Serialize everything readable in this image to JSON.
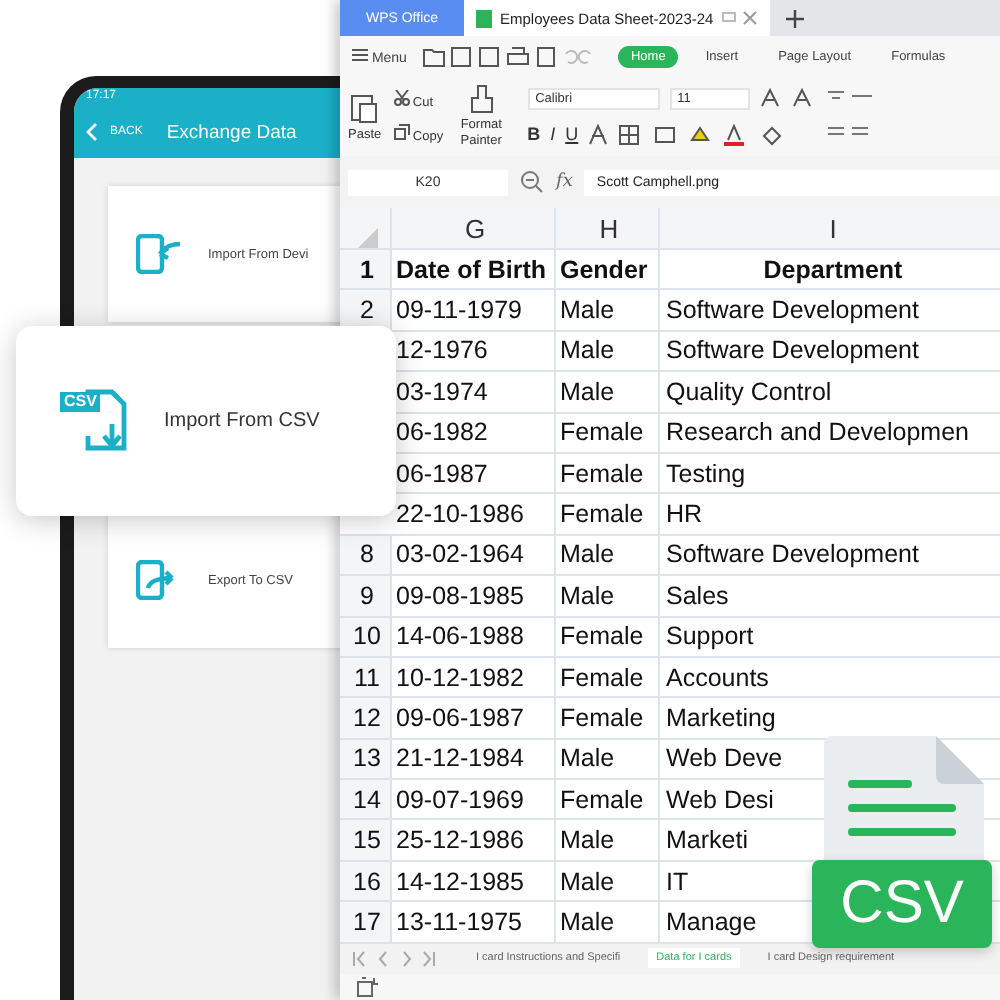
{
  "phone": {
    "time": "17:17",
    "back": "BACK",
    "title": "Exchange Data",
    "options": [
      {
        "label": "Import From Devi",
        "kind": "import"
      },
      {
        "label": "Export To CSV",
        "kind": "export"
      }
    ]
  },
  "popup_option": {
    "label": "Import From CSV",
    "badge": "CSV"
  },
  "spreadsheet": {
    "app_tab": "WPS Office",
    "doc_tab": "Employees Data Sheet-2023-24",
    "menu": "Menu",
    "ribbon_tabs": [
      {
        "label": "Home",
        "selected": true
      },
      {
        "label": "Insert",
        "selected": false
      },
      {
        "label": "Page Layout",
        "selected": false
      },
      {
        "label": "Formulas",
        "selected": false
      }
    ],
    "clipboard": {
      "paste": "Paste",
      "cut": "Cut",
      "copy": "Copy",
      "format_painter": "Format Painter"
    },
    "font": {
      "name": "Calibri",
      "size": "11"
    },
    "format_buttons": [
      "B",
      "I",
      "U"
    ],
    "cell_ref": "K20",
    "fx": "fx",
    "formula": "Scott Camphell.png",
    "columns": [
      "G",
      "H",
      "I"
    ],
    "rows": [
      {
        "num": "1",
        "kind": "header",
        "cells": [
          "Date of Birth",
          "Gender",
          "Department"
        ]
      },
      {
        "num": "2",
        "kind": "data",
        "cells": [
          "09-11-1979",
          "Male",
          "Software Development"
        ]
      },
      {
        "kind": "data",
        "cells": [
          "12-1976",
          "Male",
          "Software Development"
        ]
      },
      {
        "kind": "data",
        "cells": [
          "03-1974",
          "Male",
          "Quality Control"
        ]
      },
      {
        "kind": "data",
        "cells": [
          "06-1982",
          "Female",
          "Research and Developmen"
        ]
      },
      {
        "kind": "data",
        "cells": [
          "06-1987",
          "Female",
          "Testing"
        ]
      },
      {
        "kind": "data",
        "cells": [
          "22-10-1986",
          "Female",
          "HR"
        ]
      },
      {
        "num": "8",
        "kind": "data",
        "cells": [
          "03-02-1964",
          "Male",
          "Software Development"
        ]
      },
      {
        "num": "9",
        "kind": "data",
        "cells": [
          "09-08-1985",
          "Male",
          "Sales"
        ]
      },
      {
        "num": "10",
        "kind": "data",
        "cells": [
          "14-06-1988",
          "Female",
          "Support"
        ]
      },
      {
        "num": "11",
        "kind": "data",
        "cells": [
          "10-12-1982",
          "Female",
          "Accounts"
        ]
      },
      {
        "num": "12",
        "kind": "data",
        "cells": [
          "09-06-1987",
          "Female",
          "Marketing"
        ]
      },
      {
        "num": "13",
        "kind": "data",
        "cells": [
          "21-12-1984",
          "Male",
          "Web Deve"
        ]
      },
      {
        "num": "14",
        "kind": "data",
        "cells": [
          "09-07-1969",
          "Female",
          "Web Desi"
        ]
      },
      {
        "num": "15",
        "kind": "data",
        "cells": [
          "25-12-1986",
          "Male",
          "Marketi"
        ]
      },
      {
        "num": "16",
        "kind": "data",
        "cells": [
          "14-12-1985",
          "Male",
          "IT"
        ]
      },
      {
        "num": "17",
        "kind": "data",
        "cells": [
          "13-11-1975",
          "Male",
          "Manage"
        ]
      }
    ],
    "sheet_tabs": [
      {
        "label": "I card Instructions and Specifi",
        "selected": false
      },
      {
        "label": "Data for I cards",
        "selected": true
      },
      {
        "label": "I card Design requirement",
        "selected": false
      }
    ]
  },
  "csv_badge": "CSV"
}
